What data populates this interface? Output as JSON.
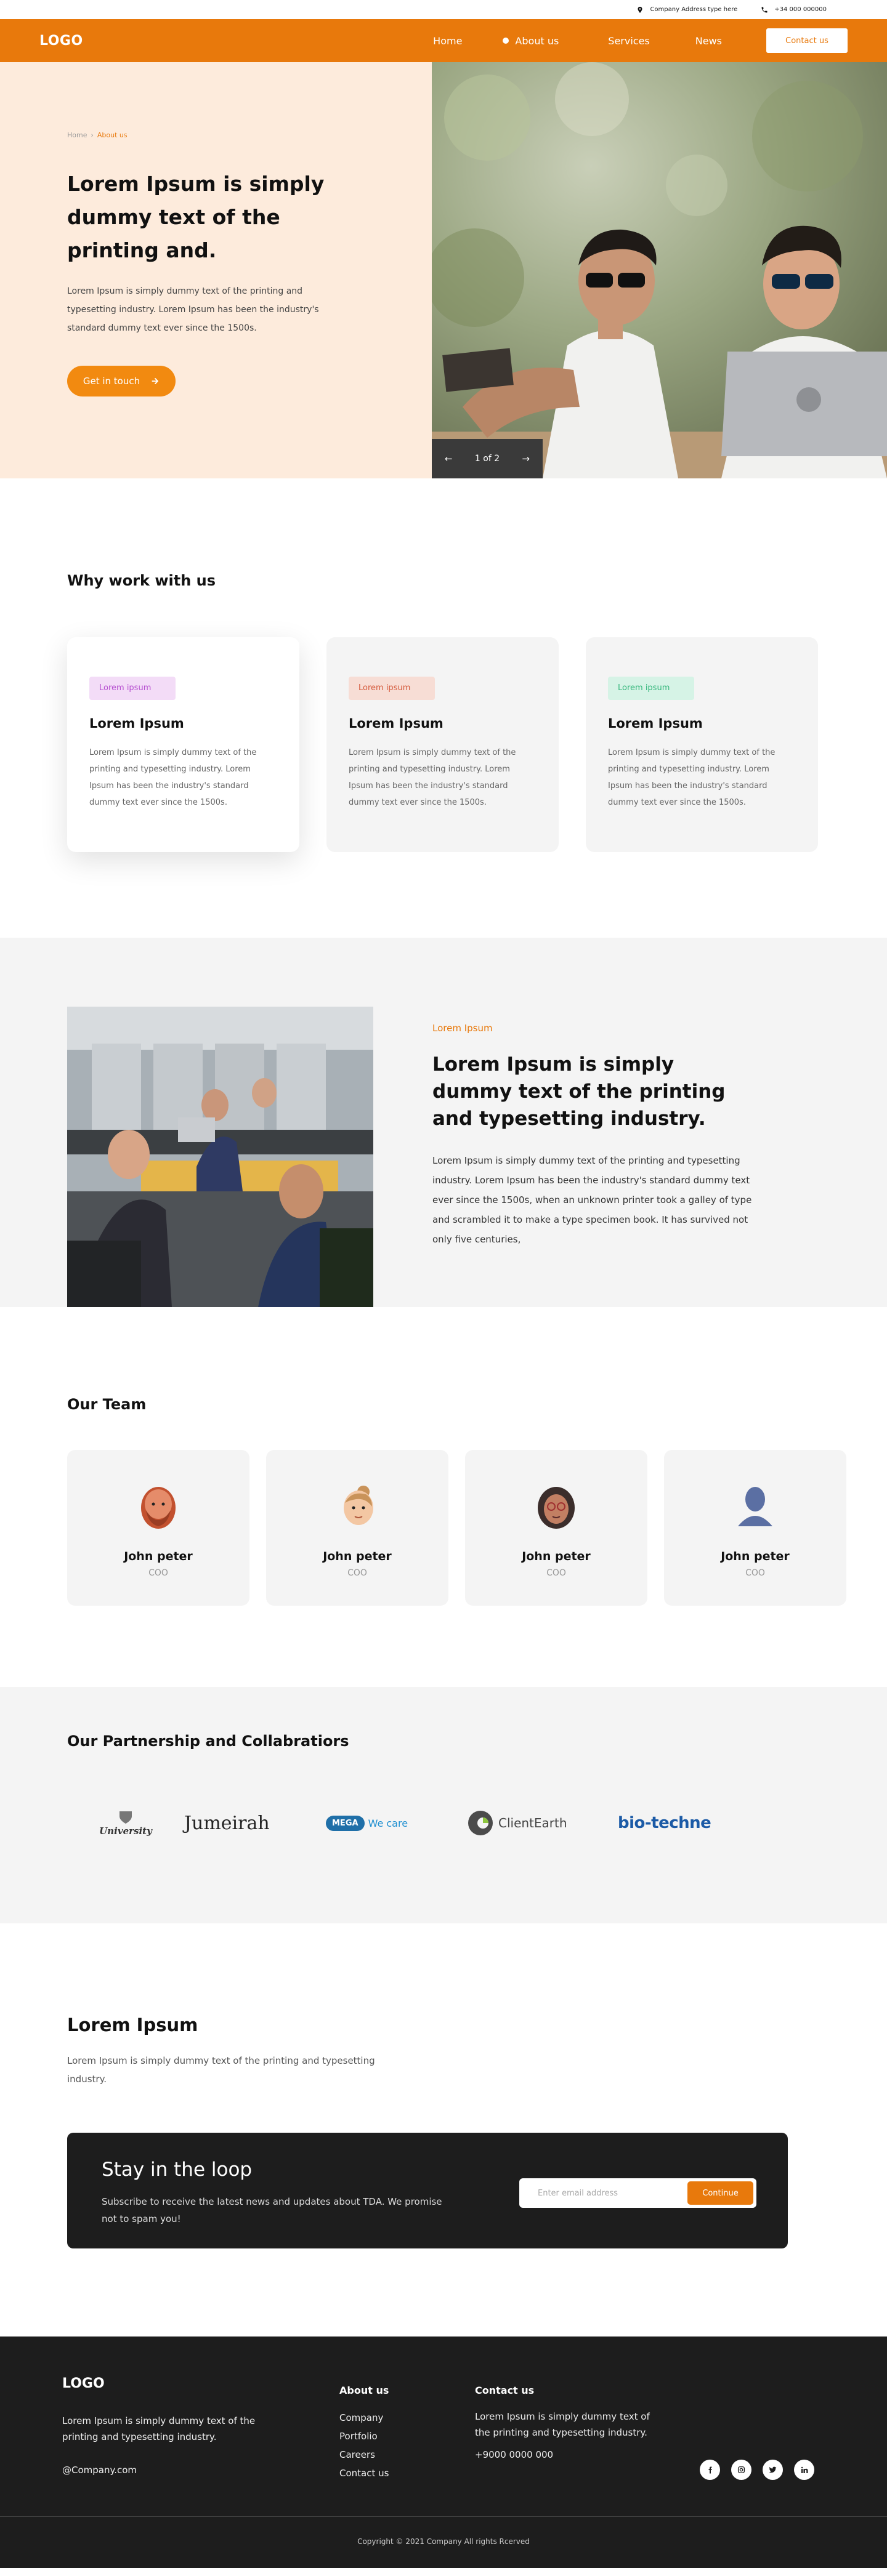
{
  "topbar": {
    "address": "Company Address type here",
    "phone": "+34 000 000000"
  },
  "nav": {
    "logo": "LOGO",
    "links": [
      "Home",
      "About us",
      "Services",
      "News"
    ],
    "active": "About us",
    "contact_label": "Contact us"
  },
  "hero": {
    "breadcrumb": [
      "Home",
      "About us"
    ],
    "title": "Lorem Ipsum is simply dummy text of the printing and.",
    "text": "Lorem Ipsum is simply dummy text of the printing and typesetting industry. Lorem Ipsum has been the industry's standard dummy text ever since the 1500s.",
    "cta_label": "Get in touch",
    "carousel_label": "1 of 2"
  },
  "why": {
    "title": "Why work with us",
    "cards": [
      {
        "tag": "Lorem ipsum",
        "title": "Lorem Ipsum",
        "text": "Lorem Ipsum is simply dummy text of the printing and typesetting industry. Lorem Ipsum has been the industry's standard dummy text ever since the 1500s.",
        "tag_bg": "#f3dcf7",
        "tag_color": "#b64fd0"
      },
      {
        "tag": "Lorem ipsum",
        "title": "Lorem Ipsum",
        "text": "Lorem Ipsum is simply dummy text of the printing and typesetting industry. Lorem Ipsum has been the industry's standard dummy text ever since the 1500s.",
        "tag_bg": "#f7ddd5",
        "tag_color": "#d4583a"
      },
      {
        "tag": "Lorem ipsum",
        "title": "Lorem Ipsum",
        "text": "Lorem Ipsum is simply dummy text of the printing and typesetting industry. Lorem Ipsum has been the industry's standard dummy text ever since the 1500s.",
        "tag_bg": "#d6f3e6",
        "tag_color": "#32b67a"
      }
    ]
  },
  "about": {
    "eyebrow": "Lorem Ipsum",
    "title": "Lorem Ipsum is simply dummy text of the printing and typesetting industry.",
    "text": "Lorem Ipsum is simply dummy text of the printing and typesetting industry. Lorem Ipsum has been the industry's standard dummy text ever since the 1500s, when an unknown printer took a galley of type and scrambled it to make a type specimen book. It has survived not only five centuries,"
  },
  "team": {
    "title": "Our Team",
    "members": [
      {
        "name": "John peter",
        "role": "COO"
      },
      {
        "name": "John peter",
        "role": "COO"
      },
      {
        "name": "John peter",
        "role": "COO"
      },
      {
        "name": "John peter",
        "role": "COO"
      }
    ]
  },
  "partners": {
    "title": "Our Partnership and Collabratiors",
    "logos": [
      "University",
      "Jumeirah",
      "MEGA",
      "We care",
      "ClientEarth",
      "bio-techne"
    ]
  },
  "cta": {
    "title": "Lorem Ipsum",
    "text": "Lorem Ipsum is simply dummy text of the printing and typesetting industry."
  },
  "newsletter": {
    "title": "Stay in the loop",
    "text": "Subscribe to receive the latest news and updates about TDA. We promise not to spam you!",
    "placeholder": "Enter email address",
    "button": "Continue"
  },
  "footer": {
    "logo": "LOGO",
    "desc": "Lorem Ipsum is simply dummy text of the printing and typesetting industry.",
    "email": "@Company.com",
    "about_head": "About us",
    "about_links": [
      "Company",
      "Portfolio",
      "Careers",
      "Contact us"
    ],
    "contact_head": "Contact us",
    "contact_text": "Lorem Ipsum is simply dummy text of the printing and typesetting industry.",
    "contact_phone": "+9000 0000 000",
    "socials": [
      "facebook-icon",
      "instagram-icon",
      "twitter-icon",
      "linkedin-icon"
    ],
    "copyright": "Copyright © 2021 Company All rights Rcerved"
  },
  "colors": {
    "brand": "#e8790c",
    "hero_bg": "#fdebdc",
    "dark": "#1d1d1d"
  }
}
